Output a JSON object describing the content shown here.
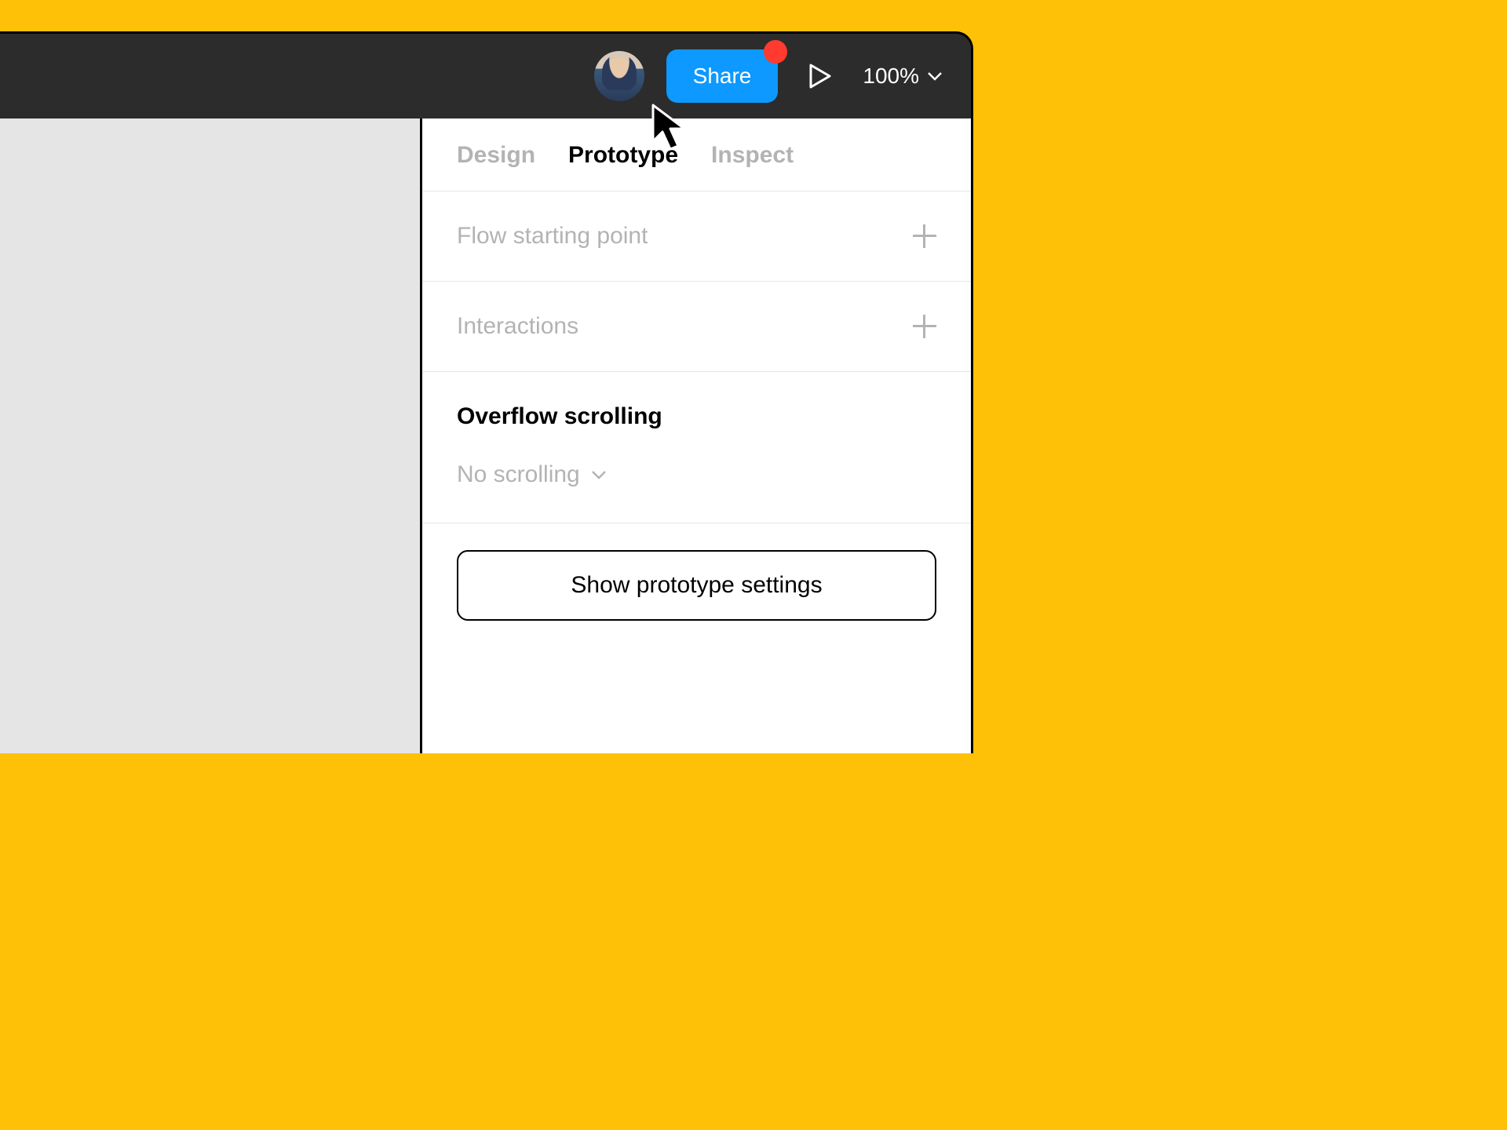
{
  "toolbar": {
    "share_label": "Share",
    "zoom_level": "100%"
  },
  "panel": {
    "tabs": [
      {
        "label": "Design",
        "active": false
      },
      {
        "label": "Prototype",
        "active": true
      },
      {
        "label": "Inspect",
        "active": false
      }
    ],
    "flow_section_label": "Flow starting point",
    "interactions_section_label": "Interactions",
    "overflow_section_label": "Overflow scrolling",
    "overflow_value": "No scrolling",
    "settings_button_label": "Show prototype settings"
  }
}
